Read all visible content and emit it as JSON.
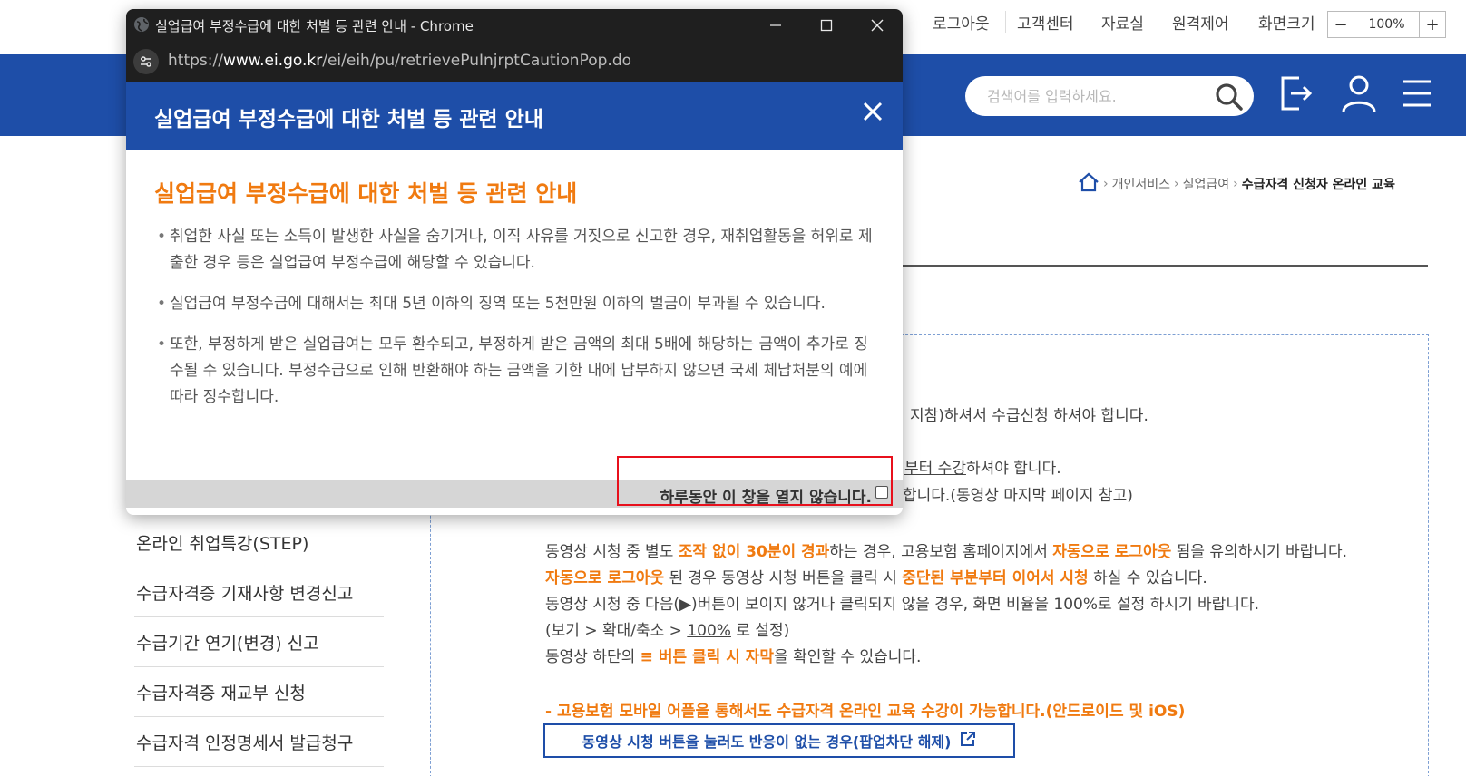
{
  "util": {
    "logout": "로그아웃",
    "customer_center": "고객센터",
    "archive": "자료실",
    "remote_control": "원격제어",
    "screen_size": "화면크기",
    "zoom_minus": "−",
    "zoom_value": "100%",
    "zoom_plus": "+"
  },
  "header": {
    "search_placeholder": "검색어를 입력하세요.",
    "icons": [
      "search-icon",
      "logout-icon",
      "user-icon",
      "menu-icon"
    ],
    "brand_color": "#1e4ea8"
  },
  "breadcrumb": {
    "items": [
      "개인서비스",
      "실업급여"
    ],
    "current": "수급자격 신청자 온라인 교육",
    "sep": "›"
  },
  "left_menu": {
    "items": [
      "온라인 취업특강(STEP)",
      "수급자격증 기재사항 변경신고",
      "수급기간 연기(변경) 신고",
      "수급자격증 재교부 신청",
      "수급자격 인정명세서 발급청구"
    ]
  },
  "content": {
    "line1_suffix": "지참)하셔서 수급신청 하셔야 합니다.",
    "line2_u": "부터 수강",
    "line2_rest": "하셔야 합니다.",
    "line3": "합니다.(동영상 마지막 페이지 참고)",
    "p1_a": "동영상 시청 중 별도 ",
    "p1_b": "조작 없이 30분이 경과",
    "p1_c": "하는 경우, 고용보험 홈페이지에서 ",
    "p1_d": "자동으로 로그아웃",
    "p1_e": " 됨을 유의하시기 바랍니다.",
    "p2_a": "자동으로 로그아웃",
    "p2_b": " 된 경우 동영상 시청 버튼을 클릭 시 ",
    "p2_c": "중단된 부분부터 이어서 시청",
    "p2_d": " 하실 수 있습니다.",
    "p3": "동영상 시청 중 다음(▶)버튼이 보이지 않거나 클릭되지 않을 경우, 화면 비율을 100%로 설정 하시기 바랍니다.",
    "p4_a": "(보기 > 확대/축소 > ",
    "p4_b": "100%",
    "p4_c": " 로 설정)",
    "p5_a": "동영상 하단의 ",
    "p5_b": "≡ 버튼 클릭 시 자막",
    "p5_c": "을 확인할 수 있습니다.",
    "mobile_note": "- 고용보험 모바일 어플을 통해서도 수급자격 온라인 교육 수강이 가능합니다.(안드로이드 및 iOS)",
    "popup_blocked_btn": "동영상 시청 버튼을 눌러도 반응이 없는 경우(팝업차단 해제)",
    "accent_color": "#f07a10"
  },
  "popup": {
    "window_title": "실업급여 부정수급에 대한 처벌 등 관련 안내 - Chrome",
    "url_prefix": "https://",
    "url_domain": "www.ei.go.kr",
    "url_path": "/ei/eih/pu/retrievePuInjrptCautionPop.do",
    "header_title": "실업급여 부정수급에 대한 처벌 등 관련 안내",
    "body_title": "실업급여 부정수급에 대한 처벌 등 관련 안내",
    "bullets": [
      "취업한 사실 또는 소득이 발생한 사실을 숨기거나, 이직 사유를 거짓으로 신고한 경우, 재취업활동을 허위로 제출한 경우 등은 실업급여 부정수급에 해당할 수 있습니다.",
      "실업급여 부정수급에 대해서는 최대 5년 이하의 징역 또는 5천만원 이하의 벌금이 부과될 수 있습니다.",
      "또한, 부정하게 받은 실업급여는 모두 환수되고, 부정하게 받은 금액의 최대 5배에 해당하는 금액이 추가로 징수될 수 있습니다. 부정수급으로 인해 반환해야 하는 금액을 기한 내에 납부하지 않으면 국세 체납처분의 예에 따라 징수합니다."
    ],
    "dont_show_today": "하루동안 이 창을 열지 않습니다.",
    "highlight_color": "#e8101c"
  }
}
